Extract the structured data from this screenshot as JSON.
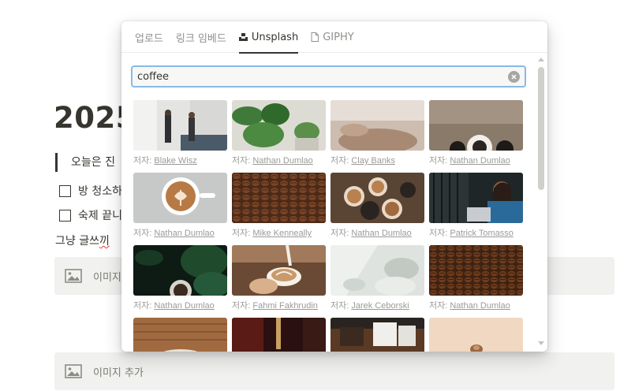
{
  "page": {
    "title": "2025",
    "quote": "오늘은 진",
    "todos": [
      "방 청소하",
      "숙제 끝니"
    ],
    "plain": "그냥 글쓰",
    "plain_mark": "끼",
    "image_block_label": "이미지",
    "image_block_full_label": "이미지 추가"
  },
  "popup": {
    "tabs": [
      "업로드",
      "링크 임베드",
      "Unsplash",
      "GIPHY"
    ],
    "active_tab": "Unsplash",
    "search_value": "coffee",
    "author_prefix": "저자:",
    "photos": [
      {
        "author": "Blake Wisz"
      },
      {
        "author": "Nathan Dumlao"
      },
      {
        "author": "Clay Banks"
      },
      {
        "author": "Nathan Dumlao"
      },
      {
        "author": "Nathan Dumlao"
      },
      {
        "author": "Mike Kenneally"
      },
      {
        "author": "Nathan Dumlao"
      },
      {
        "author": "Patrick Tomasso"
      },
      {
        "author": "Nathan Dumlao"
      },
      {
        "author": "Fahmi Fakhrudin"
      },
      {
        "author": "Jarek Ceborski"
      },
      {
        "author": "Nathan Dumlao"
      },
      {
        "author": ""
      },
      {
        "author": ""
      },
      {
        "author": ""
      },
      {
        "author": ""
      }
    ]
  },
  "colors": {
    "accent_focus": "#8ab9e6",
    "spell_error": "#e03e3e",
    "text": "#37352f",
    "muted": "#9b9a97"
  }
}
